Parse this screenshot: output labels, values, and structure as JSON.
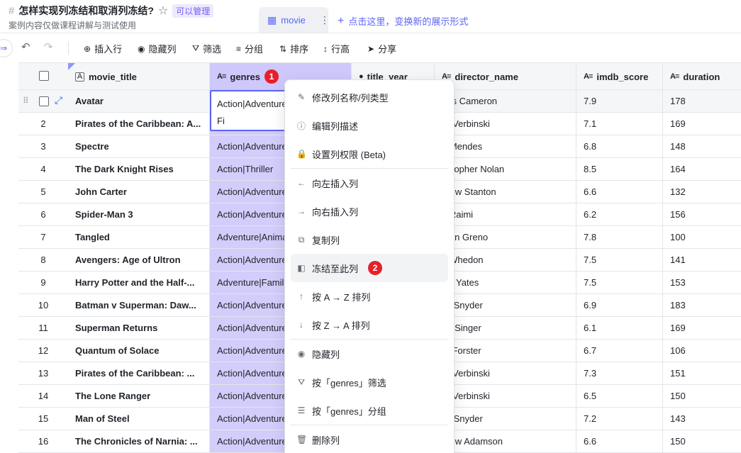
{
  "header": {
    "title": "怎样实现列冻结和取消列冻结?",
    "permission_badge": "可以管理",
    "subtitle": "案例内容仅做课程讲解与测试使用",
    "view_tab": "movie",
    "add_view": "点击这里，变换新的展示形式"
  },
  "toolbar": {
    "insert_row": "插入行",
    "hide_column": "隐藏列",
    "filter": "筛选",
    "group": "分组",
    "sort": "排序",
    "row_height": "行高",
    "share": "分享"
  },
  "columns": {
    "movie_title": "movie_title",
    "genres": "genres",
    "title_year": "title_year",
    "director_name": "director_name",
    "imdb_score": "imdb_score",
    "duration": "duration"
  },
  "annotations": {
    "badge1": "1",
    "badge2": "2"
  },
  "active_cell": {
    "line1": "Action|Adventure",
    "line2": "Fi"
  },
  "rows": [
    {
      "n": "",
      "title": "Avatar",
      "genres": "Action|Adventure",
      "director": "nes Cameron",
      "score": "7.9",
      "duration": "178"
    },
    {
      "n": "2",
      "title": "Pirates of the Caribbean: A...",
      "genres": "Action|Adventure",
      "director": "re Verbinski",
      "score": "7.1",
      "duration": "169"
    },
    {
      "n": "3",
      "title": "Spectre",
      "genres": "Action|Adventure",
      "director": "n Mendes",
      "score": "6.8",
      "duration": "148"
    },
    {
      "n": "4",
      "title": "The Dark Knight Rises",
      "genres": "Action|Thriller",
      "director": "ristopher Nolan",
      "score": "8.5",
      "duration": "164"
    },
    {
      "n": "5",
      "title": "John Carter",
      "genres": "Action|Adventure",
      "director": "drew Stanton",
      "score": "6.6",
      "duration": "132"
    },
    {
      "n": "6",
      "title": "Spider-Man 3",
      "genres": "Action|Adventure",
      "director": "n Raimi",
      "score": "6.2",
      "duration": "156"
    },
    {
      "n": "7",
      "title": "Tangled",
      "genres": "Adventure|Anima",
      "director": "than Greno",
      "score": "7.8",
      "duration": "100"
    },
    {
      "n": "8",
      "title": "Avengers: Age of Ultron",
      "genres": "Action|Adventure",
      "director": "s Whedon",
      "score": "7.5",
      "duration": "141"
    },
    {
      "n": "9",
      "title": "Harry Potter and the Half-...",
      "genres": "Adventure|Famil",
      "director": "vid Yates",
      "score": "7.5",
      "duration": "153"
    },
    {
      "n": "10",
      "title": "Batman v Superman: Daw...",
      "genres": "Action|Adventure",
      "director": "ck Snyder",
      "score": "6.9",
      "duration": "183"
    },
    {
      "n": "11",
      "title": "Superman Returns",
      "genres": "Action|Adventure",
      "director": "an Singer",
      "score": "6.1",
      "duration": "169"
    },
    {
      "n": "12",
      "title": "Quantum of Solace",
      "genres": "Action|Adventure",
      "director": "rc Forster",
      "score": "6.7",
      "duration": "106"
    },
    {
      "n": "13",
      "title": "Pirates of the Caribbean: ...",
      "genres": "Action|Adventure",
      "director": "re Verbinski",
      "score": "7.3",
      "duration": "151"
    },
    {
      "n": "14",
      "title": "The Lone Ranger",
      "genres": "Action|Adventure",
      "director": "re Verbinski",
      "score": "6.5",
      "duration": "150"
    },
    {
      "n": "15",
      "title": "Man of Steel",
      "genres": "Action|Adventure",
      "director": "ck Snyder",
      "score": "7.2",
      "duration": "143"
    },
    {
      "n": "16",
      "title": "The Chronicles of Narnia: ...",
      "genres": "Action|Adventure",
      "director": "drew Adamson",
      "score": "6.6",
      "duration": "150"
    }
  ],
  "menu": [
    {
      "icon": "✎",
      "icon_name": "edit-icon",
      "label": "修改列名称/列类型",
      "sep_after": false
    },
    {
      "icon": "ⓘ",
      "icon_name": "info-icon",
      "label": "编辑列描述",
      "sep_after": false
    },
    {
      "icon": "🔒",
      "icon_name": "lock-icon",
      "label": "设置列权限 (Beta)",
      "sep_after": true
    },
    {
      "icon": "←",
      "icon_name": "arrow-left-icon",
      "label": "向左插入列",
      "sep_after": false
    },
    {
      "icon": "→",
      "icon_name": "arrow-right-icon",
      "label": "向右插入列",
      "sep_after": false
    },
    {
      "icon": "⧉",
      "icon_name": "copy-icon",
      "label": "复制列",
      "sep_after": false
    },
    {
      "icon": "◧",
      "icon_name": "freeze-icon",
      "label": "冻结至此列",
      "sep_after": false,
      "hover": true,
      "badge": "2"
    },
    {
      "icon": "↑",
      "icon_name": "sort-asc-icon",
      "label": "按 A → Z 排列",
      "sep_after": false
    },
    {
      "icon": "↓",
      "icon_name": "sort-desc-icon",
      "label": "按 Z → A 排列",
      "sep_after": true
    },
    {
      "icon": "◉",
      "icon_name": "eye-icon",
      "label": "隐藏列",
      "sep_after": false
    },
    {
      "icon": "⛛",
      "icon_name": "filter-icon",
      "label": "按「genres」筛选",
      "sep_after": false
    },
    {
      "icon": "☰",
      "icon_name": "group-icon",
      "label": "按「genres」分组",
      "sep_after": true
    },
    {
      "icon": "🗑",
      "icon_name": "trash-icon",
      "label": "删除列",
      "sep_after": false
    }
  ]
}
